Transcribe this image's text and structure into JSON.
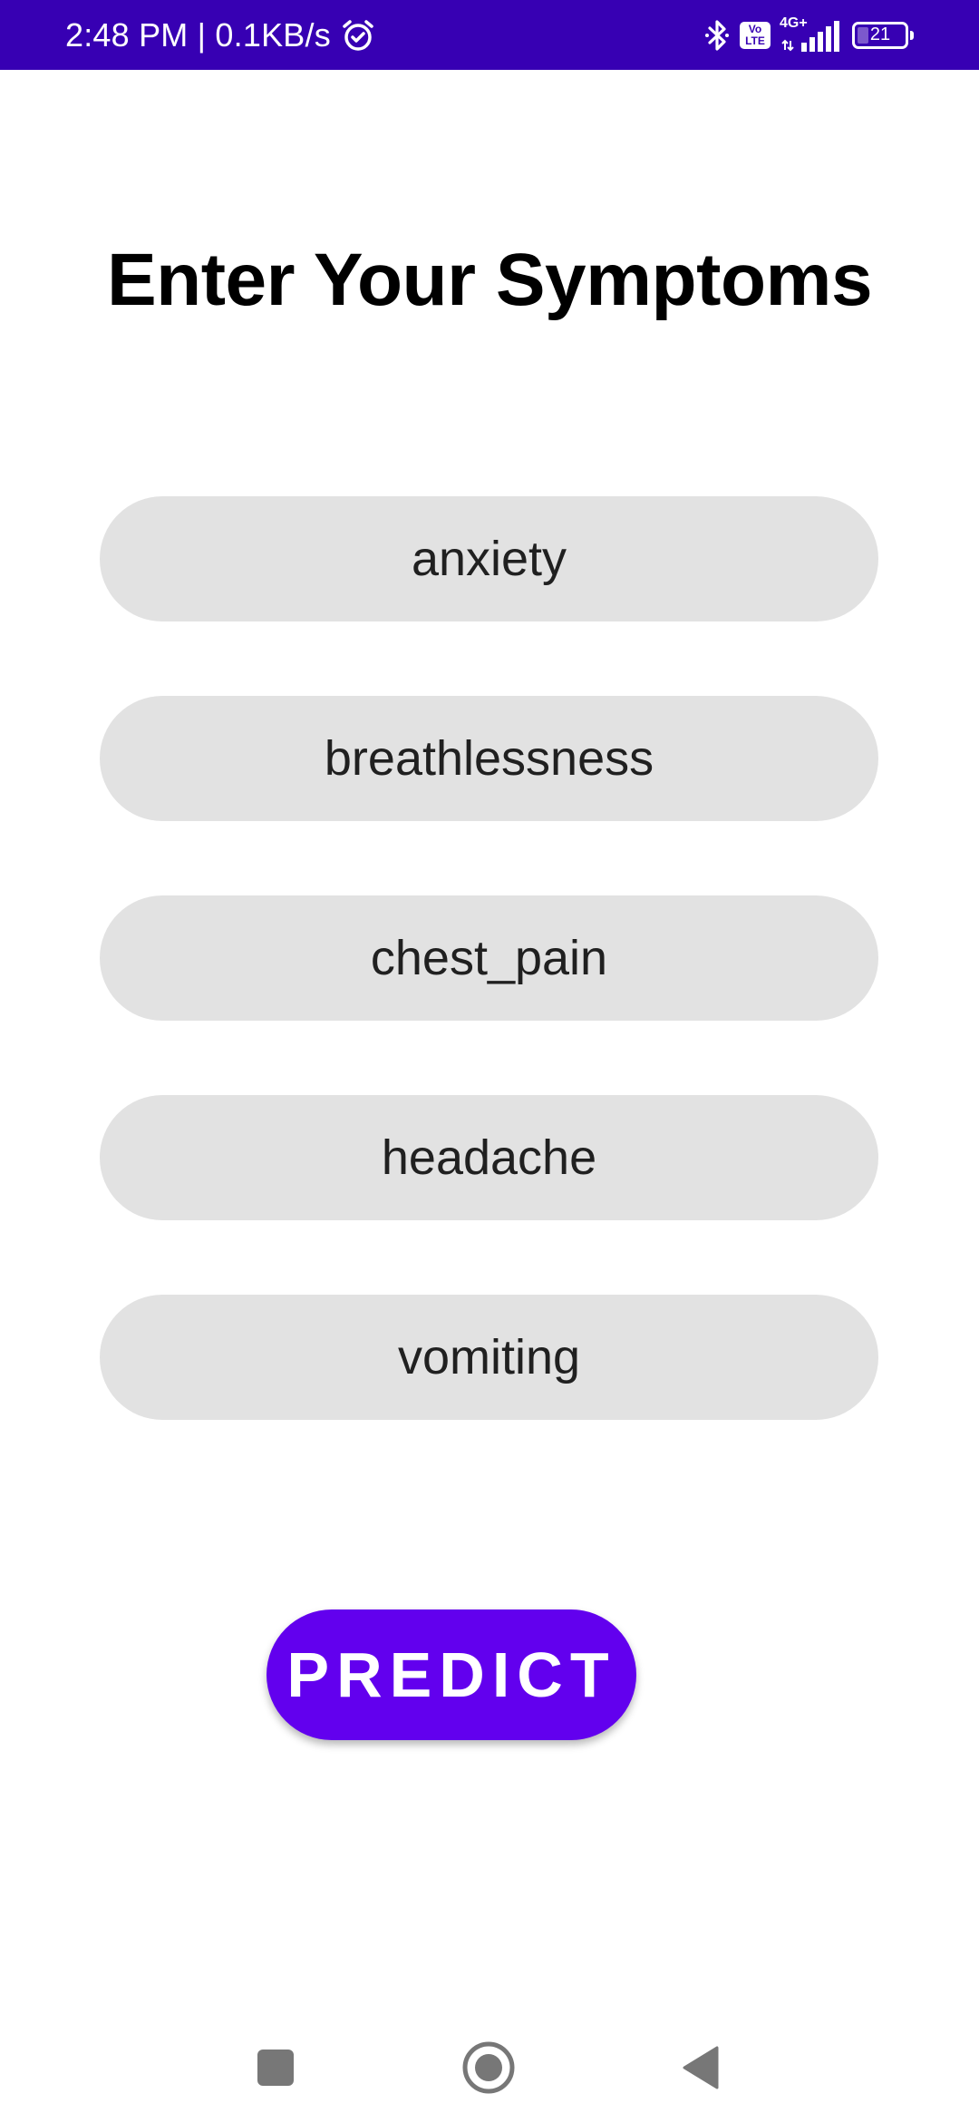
{
  "status_bar": {
    "time_speed": "2:48 PM | 0.1KB/s",
    "volte_label": "Vo\nLTE",
    "network_label": "4G+",
    "battery_level": "21",
    "color": "#3700b3"
  },
  "page": {
    "title": "Enter Your Symptoms"
  },
  "symptoms": [
    {
      "value": "anxiety"
    },
    {
      "value": "breathlessness"
    },
    {
      "value": "chest_pain"
    },
    {
      "value": "headache"
    },
    {
      "value": "vomiting"
    }
  ],
  "actions": {
    "predict_label": "PREDICT",
    "accent_color": "#6200ee"
  },
  "nav_bar": {
    "recents_icon": "square-icon",
    "home_icon": "circle-icon",
    "back_icon": "triangle-back-icon"
  }
}
